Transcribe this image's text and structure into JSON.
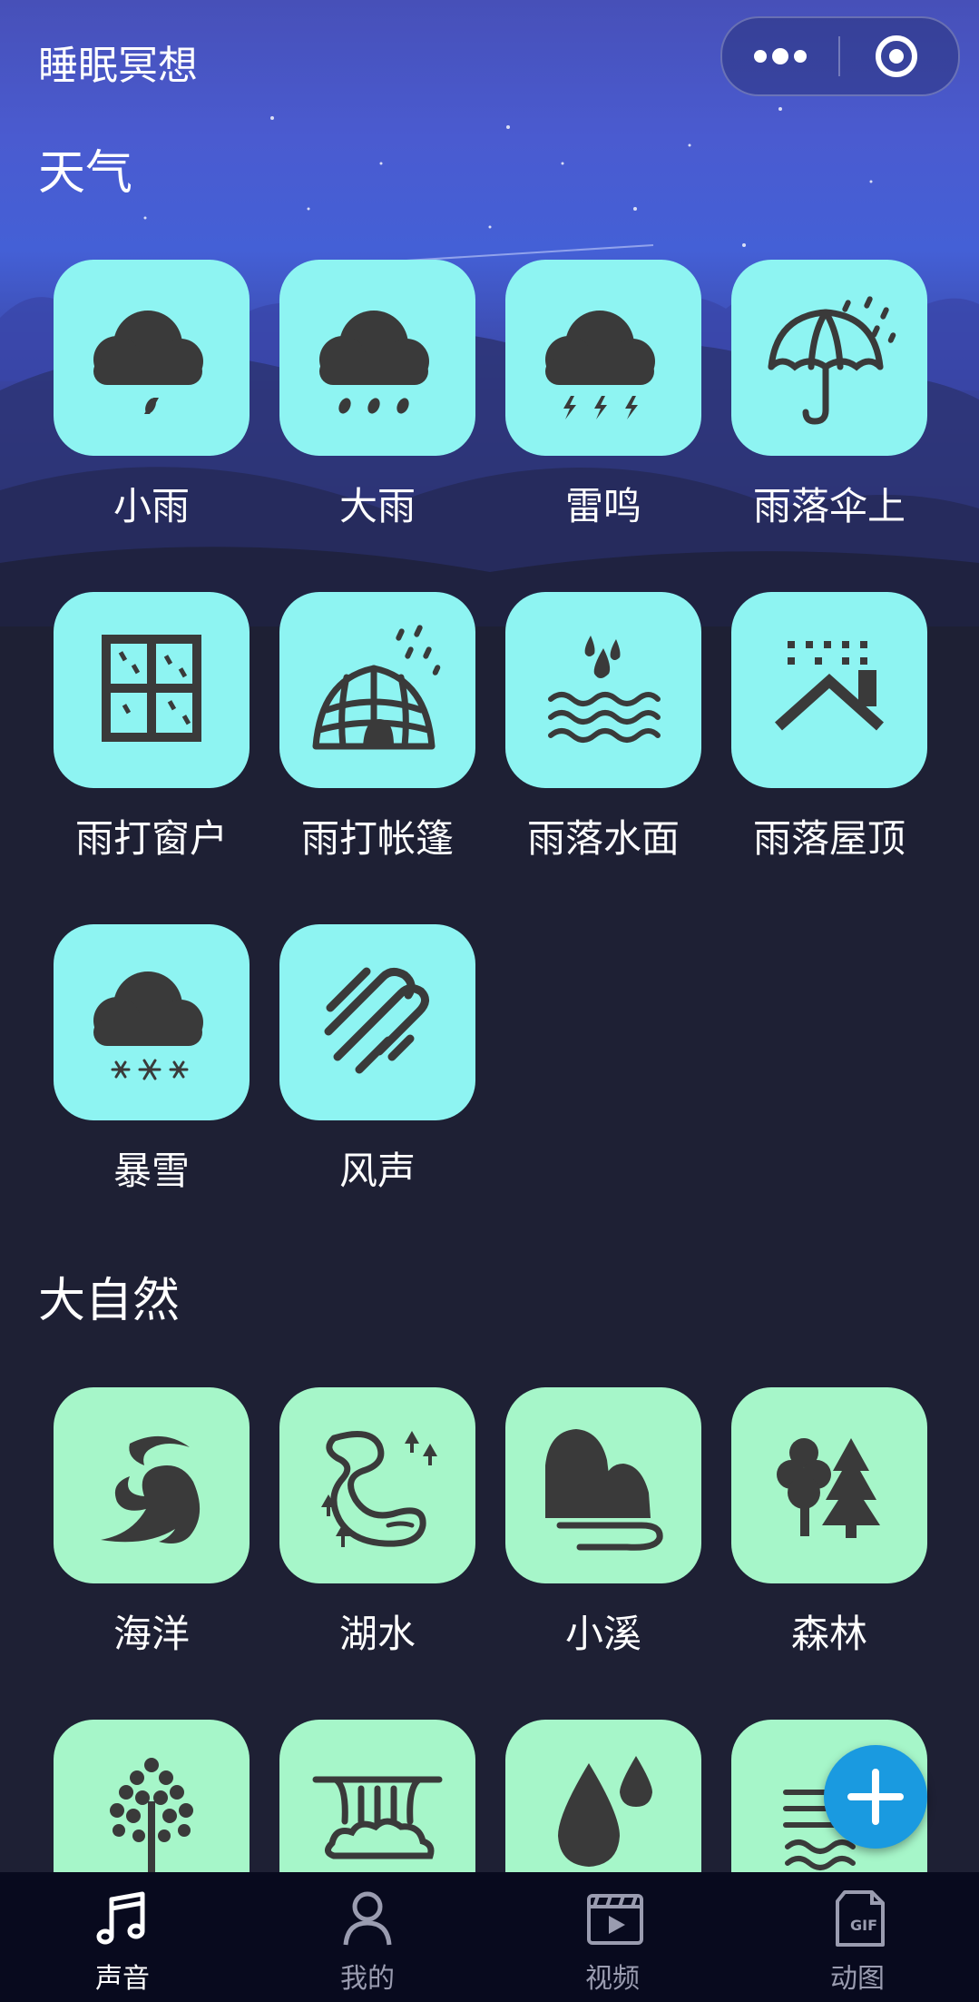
{
  "header": {
    "title": "睡眠冥想"
  },
  "sections": {
    "weather": {
      "title": "天气",
      "items": [
        "小雨",
        "大雨",
        "雷鸣",
        "雨落伞上",
        "雨打窗户",
        "雨打帐篷",
        "雨落水面",
        "雨落屋顶",
        "暴雪",
        "风声"
      ]
    },
    "nature": {
      "title": "大自然",
      "items": [
        "海洋",
        "湖水",
        "小溪",
        "森林"
      ]
    }
  },
  "tabbar": {
    "tabs": [
      {
        "label": "声音",
        "icon": "music-note-icon",
        "active": true
      },
      {
        "label": "我的",
        "icon": "person-icon",
        "active": false
      },
      {
        "label": "视频",
        "icon": "clapperboard-icon",
        "active": false
      },
      {
        "label": "动图",
        "icon": "gif-file-icon",
        "active": false
      }
    ]
  },
  "colors": {
    "weather_tile": "#8ef4f2",
    "nature_tile": "#a6f6c9",
    "icon": "#3a3a3a",
    "fab": "#1a9ae0",
    "background": "#1e2034"
  }
}
